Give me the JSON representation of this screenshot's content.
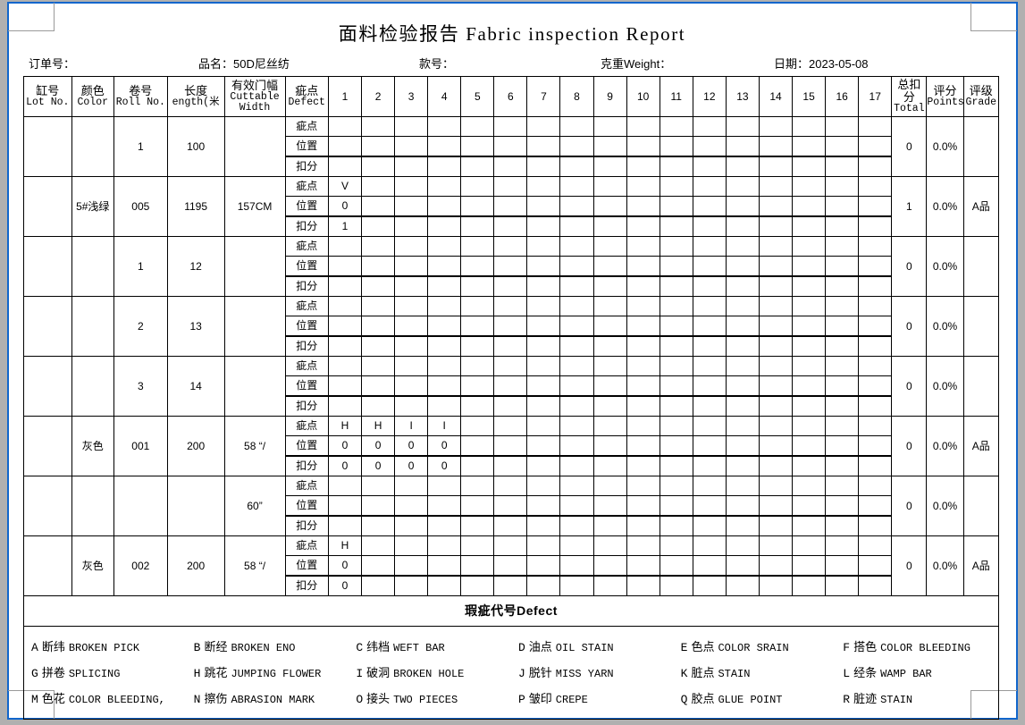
{
  "page": {
    "title": "面料检验报告 Fabric inspection Report"
  },
  "info": {
    "order_no": "订单号：",
    "product_name": "品名：50D尼丝纺",
    "style_no": "款号：",
    "weight": "克重Weight：",
    "date": "日期：2023-05-08"
  },
  "table": {
    "headers": [
      {
        "cn": "缸号",
        "en": "Lot No."
      },
      {
        "cn": "颜色",
        "en": "Color"
      },
      {
        "cn": "卷号",
        "en": "Roll No."
      },
      {
        "cn": "长度",
        "en": "ength(米"
      },
      {
        "cn": "有效门幅",
        "en": "Cuttable Width"
      },
      {
        "cn": "疵点",
        "en": "Defect"
      }
    ],
    "defect_columns": [
      "1",
      "2",
      "3",
      "4",
      "5",
      "6",
      "7",
      "8",
      "9",
      "10",
      "11",
      "12",
      "13",
      "14",
      "15",
      "16",
      "17"
    ],
    "right_headers": [
      {
        "cn": "总扣分",
        "en": "Total"
      },
      {
        "cn": "评分",
        "en": "Points"
      },
      {
        "cn": "评级",
        "en": "Grade"
      }
    ],
    "sub_rows": [
      "疵点",
      "位置",
      "扣分"
    ],
    "rows": [
      {
        "lot": "",
        "color": "",
        "roll": "1",
        "length": "100",
        "width": "",
        "defect": [
          "",
          "",
          "",
          "",
          "",
          "",
          "",
          "",
          "",
          "",
          "",
          "",
          "",
          "",
          "",
          "",
          ""
        ],
        "position": [
          "",
          "",
          "",
          "",
          "",
          "",
          "",
          "",
          "",
          "",
          "",
          "",
          "",
          "",
          "",
          "",
          ""
        ],
        "points": [
          "",
          "",
          "",
          "",
          "",
          "",
          "",
          "",
          "",
          "",
          "",
          "",
          "",
          "",
          "",
          "",
          ""
        ],
        "total": "0",
        "score": "0.0%",
        "grade": ""
      },
      {
        "lot": "",
        "color": "5#浅绿",
        "roll": "005",
        "length": "1195",
        "width": "157CM",
        "defect": [
          "V",
          "",
          "",
          "",
          "",
          "",
          "",
          "",
          "",
          "",
          "",
          "",
          "",
          "",
          "",
          "",
          ""
        ],
        "position": [
          "0",
          "",
          "",
          "",
          "",
          "",
          "",
          "",
          "",
          "",
          "",
          "",
          "",
          "",
          "",
          "",
          ""
        ],
        "points": [
          "1",
          "",
          "",
          "",
          "",
          "",
          "",
          "",
          "",
          "",
          "",
          "",
          "",
          "",
          "",
          "",
          ""
        ],
        "total": "1",
        "score": "0.0%",
        "grade": "A品"
      },
      {
        "lot": "",
        "color": "",
        "roll": "1",
        "length": "12",
        "width": "",
        "defect": [
          "",
          "",
          "",
          "",
          "",
          "",
          "",
          "",
          "",
          "",
          "",
          "",
          "",
          "",
          "",
          "",
          ""
        ],
        "position": [
          "",
          "",
          "",
          "",
          "",
          "",
          "",
          "",
          "",
          "",
          "",
          "",
          "",
          "",
          "",
          "",
          ""
        ],
        "points": [
          "",
          "",
          "",
          "",
          "",
          "",
          "",
          "",
          "",
          "",
          "",
          "",
          "",
          "",
          "",
          "",
          ""
        ],
        "total": "0",
        "score": "0.0%",
        "grade": ""
      },
      {
        "lot": "",
        "color": "",
        "roll": "2",
        "length": "13",
        "width": "",
        "defect": [
          "",
          "",
          "",
          "",
          "",
          "",
          "",
          "",
          "",
          "",
          "",
          "",
          "",
          "",
          "",
          "",
          ""
        ],
        "position": [
          "",
          "",
          "",
          "",
          "",
          "",
          "",
          "",
          "",
          "",
          "",
          "",
          "",
          "",
          "",
          "",
          ""
        ],
        "points": [
          "",
          "",
          "",
          "",
          "",
          "",
          "",
          "",
          "",
          "",
          "",
          "",
          "",
          "",
          "",
          "",
          ""
        ],
        "total": "0",
        "score": "0.0%",
        "grade": ""
      },
      {
        "lot": "",
        "color": "",
        "roll": "3",
        "length": "14",
        "width": "",
        "defect": [
          "",
          "",
          "",
          "",
          "",
          "",
          "",
          "",
          "",
          "",
          "",
          "",
          "",
          "",
          "",
          "",
          ""
        ],
        "position": [
          "",
          "",
          "",
          "",
          "",
          "",
          "",
          "",
          "",
          "",
          "",
          "",
          "",
          "",
          "",
          "",
          ""
        ],
        "points": [
          "",
          "",
          "",
          "",
          "",
          "",
          "",
          "",
          "",
          "",
          "",
          "",
          "",
          "",
          "",
          "",
          ""
        ],
        "total": "0",
        "score": "0.0%",
        "grade": ""
      },
      {
        "lot": "",
        "color": "灰色",
        "roll": "001",
        "length": "200",
        "width": "58 “/",
        "defect": [
          "H",
          "H",
          "I",
          "I",
          "",
          "",
          "",
          "",
          "",
          "",
          "",
          "",
          "",
          "",
          "",
          "",
          ""
        ],
        "position": [
          "0",
          "0",
          "0",
          "0",
          "",
          "",
          "",
          "",
          "",
          "",
          "",
          "",
          "",
          "",
          "",
          "",
          ""
        ],
        "points": [
          "0",
          "0",
          "0",
          "0",
          "",
          "",
          "",
          "",
          "",
          "",
          "",
          "",
          "",
          "",
          "",
          "",
          ""
        ],
        "total": "0",
        "score": "0.0%",
        "grade": "A品"
      },
      {
        "lot": "",
        "color": "",
        "roll": "",
        "length": "",
        "width": "60”",
        "defect": [
          "",
          "",
          "",
          "",
          "",
          "",
          "",
          "",
          "",
          "",
          "",
          "",
          "",
          "",
          "",
          "",
          ""
        ],
        "position": [
          "",
          "",
          "",
          "",
          "",
          "",
          "",
          "",
          "",
          "",
          "",
          "",
          "",
          "",
          "",
          "",
          ""
        ],
        "points": [
          "",
          "",
          "",
          "",
          "",
          "",
          "",
          "",
          "",
          "",
          "",
          "",
          "",
          "",
          "",
          "",
          ""
        ],
        "total": "0",
        "score": "0.0%",
        "grade": ""
      },
      {
        "lot": "",
        "color": "灰色",
        "roll": "002",
        "length": "200",
        "width": "58 “/",
        "defect": [
          "H",
          "",
          "",
          "",
          "",
          "",
          "",
          "",
          "",
          "",
          "",
          "",
          "",
          "",
          "",
          "",
          ""
        ],
        "position": [
          "0",
          "",
          "",
          "",
          "",
          "",
          "",
          "",
          "",
          "",
          "",
          "",
          "",
          "",
          "",
          "",
          ""
        ],
        "points": [
          "0",
          "",
          "",
          "",
          "",
          "",
          "",
          "",
          "",
          "",
          "",
          "",
          "",
          "",
          "",
          "",
          ""
        ],
        "total": "0",
        "score": "0.0%",
        "grade": "A品"
      }
    ]
  },
  "legend": {
    "title": "瑕疵代号Defect",
    "items": [
      {
        "code": "A",
        "cn": "断纬",
        "en": "BROKEN PICK"
      },
      {
        "code": "B",
        "cn": "断经",
        "en": "BROKEN ENO"
      },
      {
        "code": "C",
        "cn": "纬档",
        "en": "WEFT BAR"
      },
      {
        "code": "D",
        "cn": "油点",
        "en": "OIL STAIN"
      },
      {
        "code": "E",
        "cn": "色点",
        "en": "COLOR SRAIN"
      },
      {
        "code": "F",
        "cn": "搭色",
        "en": "COLOR BLEEDING"
      },
      {
        "code": "G",
        "cn": "拼卷",
        "en": "SPLICING"
      },
      {
        "code": "H",
        "cn": "跳花",
        "en": "JUMPING FLOWER"
      },
      {
        "code": "I",
        "cn": "破洞",
        "en": "BROKEN HOLE"
      },
      {
        "code": "J",
        "cn": "脱针",
        "en": "MISS YARN"
      },
      {
        "code": "K",
        "cn": "脏点",
        "en": "STAIN"
      },
      {
        "code": "L",
        "cn": "经条",
        "en": "WAMP BAR"
      },
      {
        "code": "M",
        "cn": "色花",
        "en": "COLOR BLEEDING,"
      },
      {
        "code": "N",
        "cn": "擦伤",
        "en": "ABRASION MARK"
      },
      {
        "code": "O",
        "cn": "接头",
        "en": "TWO PIECES"
      },
      {
        "code": "P",
        "cn": "皱印",
        "en": "CREPE"
      },
      {
        "code": "Q",
        "cn": "胶点",
        "en": "GLUE POINT"
      },
      {
        "code": "R",
        "cn": "脏迹",
        "en": "STAIN"
      }
    ]
  },
  "colors": {
    "page_border": "#1166cc",
    "background": "#b0b0b0",
    "paper": "#ffffff",
    "grid_line": "#000000"
  }
}
